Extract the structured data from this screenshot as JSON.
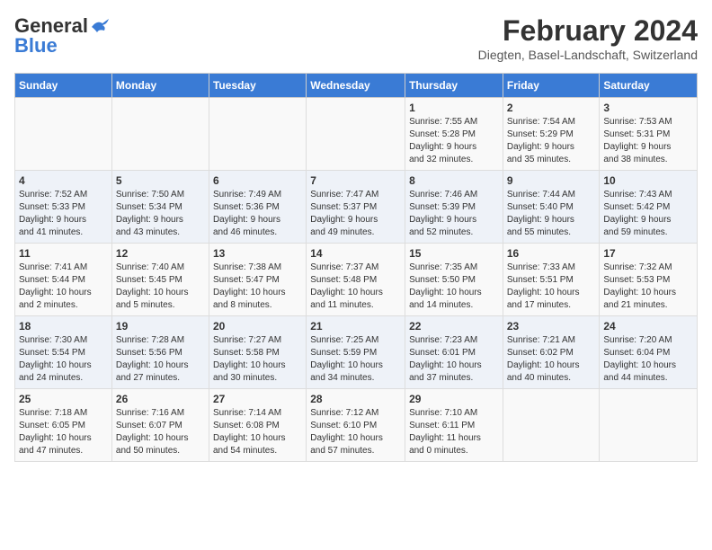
{
  "logo": {
    "text_general": "General",
    "text_blue": "Blue"
  },
  "header": {
    "month": "February 2024",
    "location": "Diegten, Basel-Landschaft, Switzerland"
  },
  "weekdays": [
    "Sunday",
    "Monday",
    "Tuesday",
    "Wednesday",
    "Thursday",
    "Friday",
    "Saturday"
  ],
  "weeks": [
    [
      {
        "day": "",
        "info": ""
      },
      {
        "day": "",
        "info": ""
      },
      {
        "day": "",
        "info": ""
      },
      {
        "day": "",
        "info": ""
      },
      {
        "day": "1",
        "info": "Sunrise: 7:55 AM\nSunset: 5:28 PM\nDaylight: 9 hours\nand 32 minutes."
      },
      {
        "day": "2",
        "info": "Sunrise: 7:54 AM\nSunset: 5:29 PM\nDaylight: 9 hours\nand 35 minutes."
      },
      {
        "day": "3",
        "info": "Sunrise: 7:53 AM\nSunset: 5:31 PM\nDaylight: 9 hours\nand 38 minutes."
      }
    ],
    [
      {
        "day": "4",
        "info": "Sunrise: 7:52 AM\nSunset: 5:33 PM\nDaylight: 9 hours\nand 41 minutes."
      },
      {
        "day": "5",
        "info": "Sunrise: 7:50 AM\nSunset: 5:34 PM\nDaylight: 9 hours\nand 43 minutes."
      },
      {
        "day": "6",
        "info": "Sunrise: 7:49 AM\nSunset: 5:36 PM\nDaylight: 9 hours\nand 46 minutes."
      },
      {
        "day": "7",
        "info": "Sunrise: 7:47 AM\nSunset: 5:37 PM\nDaylight: 9 hours\nand 49 minutes."
      },
      {
        "day": "8",
        "info": "Sunrise: 7:46 AM\nSunset: 5:39 PM\nDaylight: 9 hours\nand 52 minutes."
      },
      {
        "day": "9",
        "info": "Sunrise: 7:44 AM\nSunset: 5:40 PM\nDaylight: 9 hours\nand 55 minutes."
      },
      {
        "day": "10",
        "info": "Sunrise: 7:43 AM\nSunset: 5:42 PM\nDaylight: 9 hours\nand 59 minutes."
      }
    ],
    [
      {
        "day": "11",
        "info": "Sunrise: 7:41 AM\nSunset: 5:44 PM\nDaylight: 10 hours\nand 2 minutes."
      },
      {
        "day": "12",
        "info": "Sunrise: 7:40 AM\nSunset: 5:45 PM\nDaylight: 10 hours\nand 5 minutes."
      },
      {
        "day": "13",
        "info": "Sunrise: 7:38 AM\nSunset: 5:47 PM\nDaylight: 10 hours\nand 8 minutes."
      },
      {
        "day": "14",
        "info": "Sunrise: 7:37 AM\nSunset: 5:48 PM\nDaylight: 10 hours\nand 11 minutes."
      },
      {
        "day": "15",
        "info": "Sunrise: 7:35 AM\nSunset: 5:50 PM\nDaylight: 10 hours\nand 14 minutes."
      },
      {
        "day": "16",
        "info": "Sunrise: 7:33 AM\nSunset: 5:51 PM\nDaylight: 10 hours\nand 17 minutes."
      },
      {
        "day": "17",
        "info": "Sunrise: 7:32 AM\nSunset: 5:53 PM\nDaylight: 10 hours\nand 21 minutes."
      }
    ],
    [
      {
        "day": "18",
        "info": "Sunrise: 7:30 AM\nSunset: 5:54 PM\nDaylight: 10 hours\nand 24 minutes."
      },
      {
        "day": "19",
        "info": "Sunrise: 7:28 AM\nSunset: 5:56 PM\nDaylight: 10 hours\nand 27 minutes."
      },
      {
        "day": "20",
        "info": "Sunrise: 7:27 AM\nSunset: 5:58 PM\nDaylight: 10 hours\nand 30 minutes."
      },
      {
        "day": "21",
        "info": "Sunrise: 7:25 AM\nSunset: 5:59 PM\nDaylight: 10 hours\nand 34 minutes."
      },
      {
        "day": "22",
        "info": "Sunrise: 7:23 AM\nSunset: 6:01 PM\nDaylight: 10 hours\nand 37 minutes."
      },
      {
        "day": "23",
        "info": "Sunrise: 7:21 AM\nSunset: 6:02 PM\nDaylight: 10 hours\nand 40 minutes."
      },
      {
        "day": "24",
        "info": "Sunrise: 7:20 AM\nSunset: 6:04 PM\nDaylight: 10 hours\nand 44 minutes."
      }
    ],
    [
      {
        "day": "25",
        "info": "Sunrise: 7:18 AM\nSunset: 6:05 PM\nDaylight: 10 hours\nand 47 minutes."
      },
      {
        "day": "26",
        "info": "Sunrise: 7:16 AM\nSunset: 6:07 PM\nDaylight: 10 hours\nand 50 minutes."
      },
      {
        "day": "27",
        "info": "Sunrise: 7:14 AM\nSunset: 6:08 PM\nDaylight: 10 hours\nand 54 minutes."
      },
      {
        "day": "28",
        "info": "Sunrise: 7:12 AM\nSunset: 6:10 PM\nDaylight: 10 hours\nand 57 minutes."
      },
      {
        "day": "29",
        "info": "Sunrise: 7:10 AM\nSunset: 6:11 PM\nDaylight: 11 hours\nand 0 minutes."
      },
      {
        "day": "",
        "info": ""
      },
      {
        "day": "",
        "info": ""
      }
    ]
  ]
}
